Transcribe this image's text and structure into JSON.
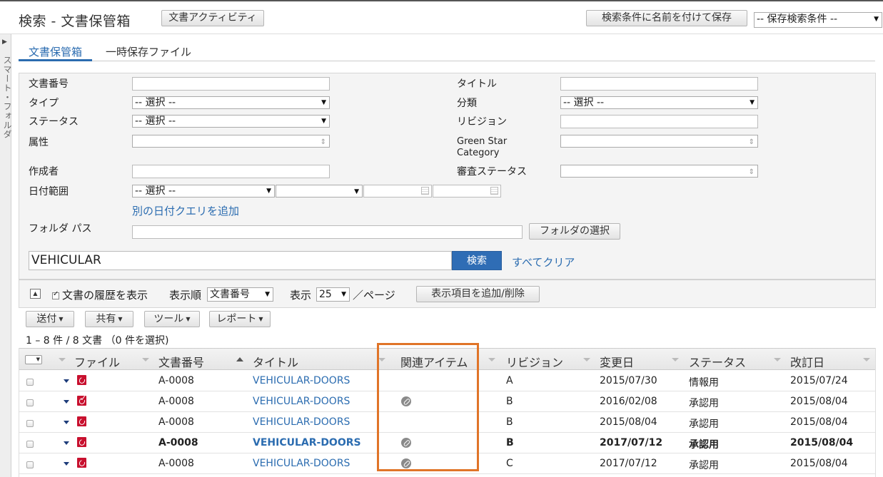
{
  "header": {
    "title": "検索 - 文書保管箱",
    "doc_activity": "文書アクティビティ",
    "save_search": "検索条件に名前を付けて保存",
    "saved_search_select": "-- 保存検索条件 --"
  },
  "side_panel": {
    "label": "スマート・フォルダ"
  },
  "tabs": [
    {
      "label": "文書保管箱"
    },
    {
      "label": "一時保存ファイル"
    }
  ],
  "form": {
    "doc_number_label": "文書番号",
    "title_label": "タイトル",
    "type_label": "タイプ",
    "type_value": "-- 選択 --",
    "category_label": "分類",
    "category_value": "-- 選択 --",
    "status_label": "ステータス",
    "status_value": "-- 選択 --",
    "revision_label": "リビジョン",
    "attribute_label": "属性",
    "green_star_label": "Green Star Category",
    "author_label": "作成者",
    "review_status_label": "審査ステータス",
    "date_range_label": "日付範囲",
    "date_range_value": "-- 選択 --",
    "add_date_query": "別の日付クエリを追加",
    "folder_path_label": "フォルダ パス",
    "folder_select": "フォルダの選択",
    "keyword": "VEHICULAR",
    "search": "検索",
    "clear_all": "すべてクリア"
  },
  "toolbar": {
    "show_history": "文書の履歴を表示",
    "sort_label": "表示順",
    "sort_value": "文書番号",
    "show_label": "表示",
    "page_size": "25",
    "per_page": "／ページ",
    "add_remove_columns": "表示項目を追加/削除"
  },
  "actions": {
    "send": "送付",
    "share": "共有",
    "tools": "ツール",
    "report": "レポート"
  },
  "result_count": "1 – 8 件 / 8 文書 （0 件を選択)",
  "grid": {
    "columns": {
      "file": "ファイル",
      "doc_number": "文書番号",
      "title": "タイトル",
      "related": "関連アイテム",
      "revision": "リビジョン",
      "modified": "変更日",
      "status": "ステータス",
      "revised": "改訂日"
    },
    "rows": [
      {
        "doc_number": "A-0008",
        "title": "VEHICULAR-DOORS",
        "related": false,
        "revision": "A",
        "modified": "2015/07/30",
        "status": "情報用",
        "revised": "2015/07/24",
        "bold": false,
        "pdf_check": false
      },
      {
        "doc_number": "A-0008",
        "title": "VEHICULAR-DOORS",
        "related": true,
        "revision": "B",
        "modified": "2016/02/08",
        "status": "承認用",
        "revised": "2015/08/04",
        "bold": false,
        "pdf_check": true
      },
      {
        "doc_number": "A-0008",
        "title": "VEHICULAR-DOORS",
        "related": false,
        "revision": "B",
        "modified": "2015/08/04",
        "status": "承認用",
        "revised": "2015/08/04",
        "bold": false,
        "pdf_check": false
      },
      {
        "doc_number": "A-0008",
        "title": "VEHICULAR-DOORS",
        "related": true,
        "revision": "B",
        "modified": "2017/07/12",
        "status": "承認用",
        "revised": "2015/08/04",
        "bold": true,
        "pdf_check": false
      },
      {
        "doc_number": "A-0008",
        "title": "VEHICULAR-DOORS",
        "related": true,
        "revision": "C",
        "modified": "2017/07/12",
        "status": "承認用",
        "revised": "2015/08/04",
        "bold": false,
        "pdf_check": false
      }
    ]
  },
  "colors": {
    "accent": "#2b6cb0",
    "search_button": "#2f6db5",
    "highlight": "#e07428",
    "pdf": "#c8102e"
  }
}
